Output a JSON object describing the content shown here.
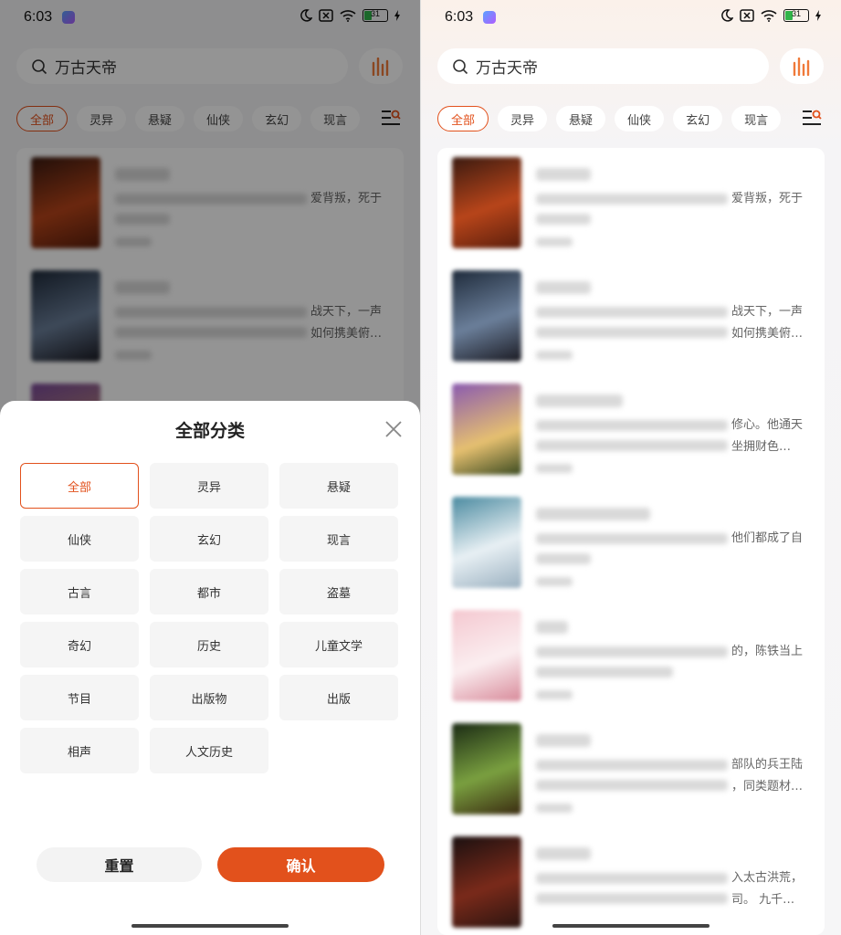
{
  "status": {
    "time": "6:03",
    "battery": "31"
  },
  "search": {
    "query": "万古天帝"
  },
  "categories": [
    "全部",
    "灵异",
    "悬疑",
    "仙侠",
    "玄幻",
    "现言"
  ],
  "books_right": [
    {
      "line1": "爱背叛，死于",
      "line2": ""
    },
    {
      "line1": "战天下，一声",
      "line2": "如何携美俯…"
    },
    {
      "line1": "修心。他通天",
      "line2": "坐拥财色…"
    },
    {
      "line1": "他们都成了自",
      "line2": ""
    },
    {
      "line1": "的，陈铁当上",
      "line2": ""
    },
    {
      "line1": "部队的兵王陆",
      "line2": "，同类题材…"
    },
    {
      "line1": "入太古洪荒，",
      "line2": "司。 九千…"
    }
  ],
  "books_left": [
    {
      "line1": "爱背叛，死于",
      "line2": ""
    },
    {
      "line1": "战天下，一声",
      "line2": "如何携美俯…"
    }
  ],
  "partial_title": "梨中里爷将州",
  "sheet": {
    "title": "全部分类",
    "options": [
      "全部",
      "灵异",
      "悬疑",
      "仙侠",
      "玄幻",
      "现言",
      "古言",
      "都市",
      "盗墓",
      "奇幻",
      "历史",
      "儿童文学",
      "节目",
      "出版物",
      "出版",
      "相声",
      "人文历史"
    ],
    "reset_label": "重置",
    "confirm_label": "确认"
  },
  "colors": {
    "accent": "#e2511c",
    "rank_icon": "#f07a3a"
  }
}
